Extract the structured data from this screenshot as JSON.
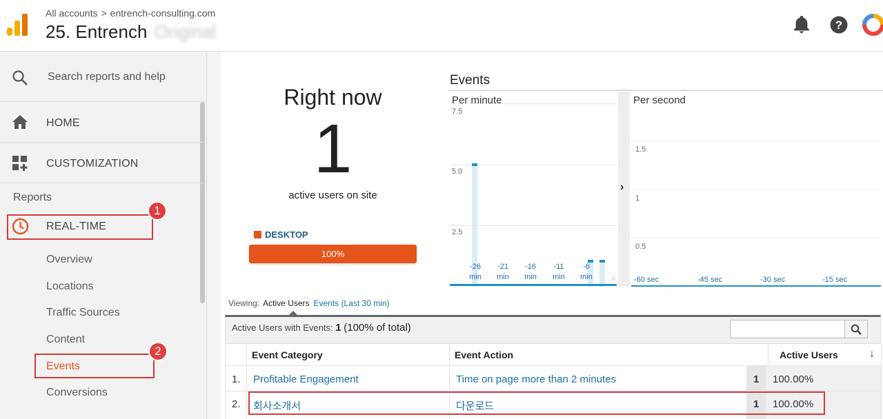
{
  "header": {
    "breadcrumb_root": "All accounts",
    "breadcrumb_sep": ">",
    "breadcrumb_account": "entrench-consulting.com",
    "property_title": "25. Entrench",
    "view_name_blurred": "Original",
    "icons": [
      "bell-icon",
      "help-icon",
      "avatar"
    ]
  },
  "sidebar": {
    "search_placeholder": "Search reports and help",
    "home_label": "HOME",
    "customization_label": "CUSTOMIZATION",
    "reports_label": "Reports",
    "realtime_label": "REAL-TIME",
    "realtime_items": [
      "Overview",
      "Locations",
      "Traffic Sources",
      "Content",
      "Events",
      "Conversions"
    ],
    "badges": [
      "1",
      "2"
    ]
  },
  "right_now": {
    "title": "Right now",
    "value": "1",
    "subtitle": "active users on site",
    "device_label": "DESKTOP",
    "device_percent": "100%",
    "device_fraction": 1.0
  },
  "events_chart": {
    "title": "Events",
    "per_minute": {
      "label": "Per minute",
      "y_ticks": [
        "7.5",
        "5.0",
        "2.5"
      ],
      "x_ticks": [
        {
          "top": "-26",
          "bottom": "min"
        },
        {
          "top": "-21",
          "bottom": "min"
        },
        {
          "top": "-16",
          "bottom": "min"
        },
        {
          "top": "-11",
          "bottom": "min"
        },
        {
          "top": "-6",
          "bottom": "min"
        },
        {
          "top": "..",
          "bottom": ""
        }
      ]
    },
    "per_second": {
      "label": "Per second",
      "y_ticks": [
        "1.5",
        "1",
        "0.5"
      ],
      "x_ticks": [
        "-60 sec",
        "-45 sec",
        "-30 sec",
        "-15 sec"
      ]
    },
    "expand_glyph": "›"
  },
  "viewing": {
    "label": "Viewing:",
    "active_tab": "Active Users",
    "other_tab": "Events (Last 30 min)"
  },
  "table": {
    "summary_label": "Active Users with Events:",
    "summary_value": "1",
    "summary_pct": "(100% of total)",
    "search_placeholder": "",
    "columns": [
      "Event Category",
      "Event Action",
      "Active Users"
    ],
    "sort_glyph": "↓",
    "rows": [
      {
        "index": "1.",
        "category": "Profitable Engagement",
        "action": "Time on page more than 2 minutes",
        "users": "1",
        "pct": "100.00%"
      },
      {
        "index": "2.",
        "category": "회사소개서",
        "action": "다운로드",
        "users": "1",
        "pct": "100.00%"
      }
    ]
  },
  "colors": {
    "accent_orange": "#e5541b",
    "link_blue": "#1d6fa5",
    "annotation_red": "#d63a3a",
    "chart_bar": "#1f8fc8"
  }
}
